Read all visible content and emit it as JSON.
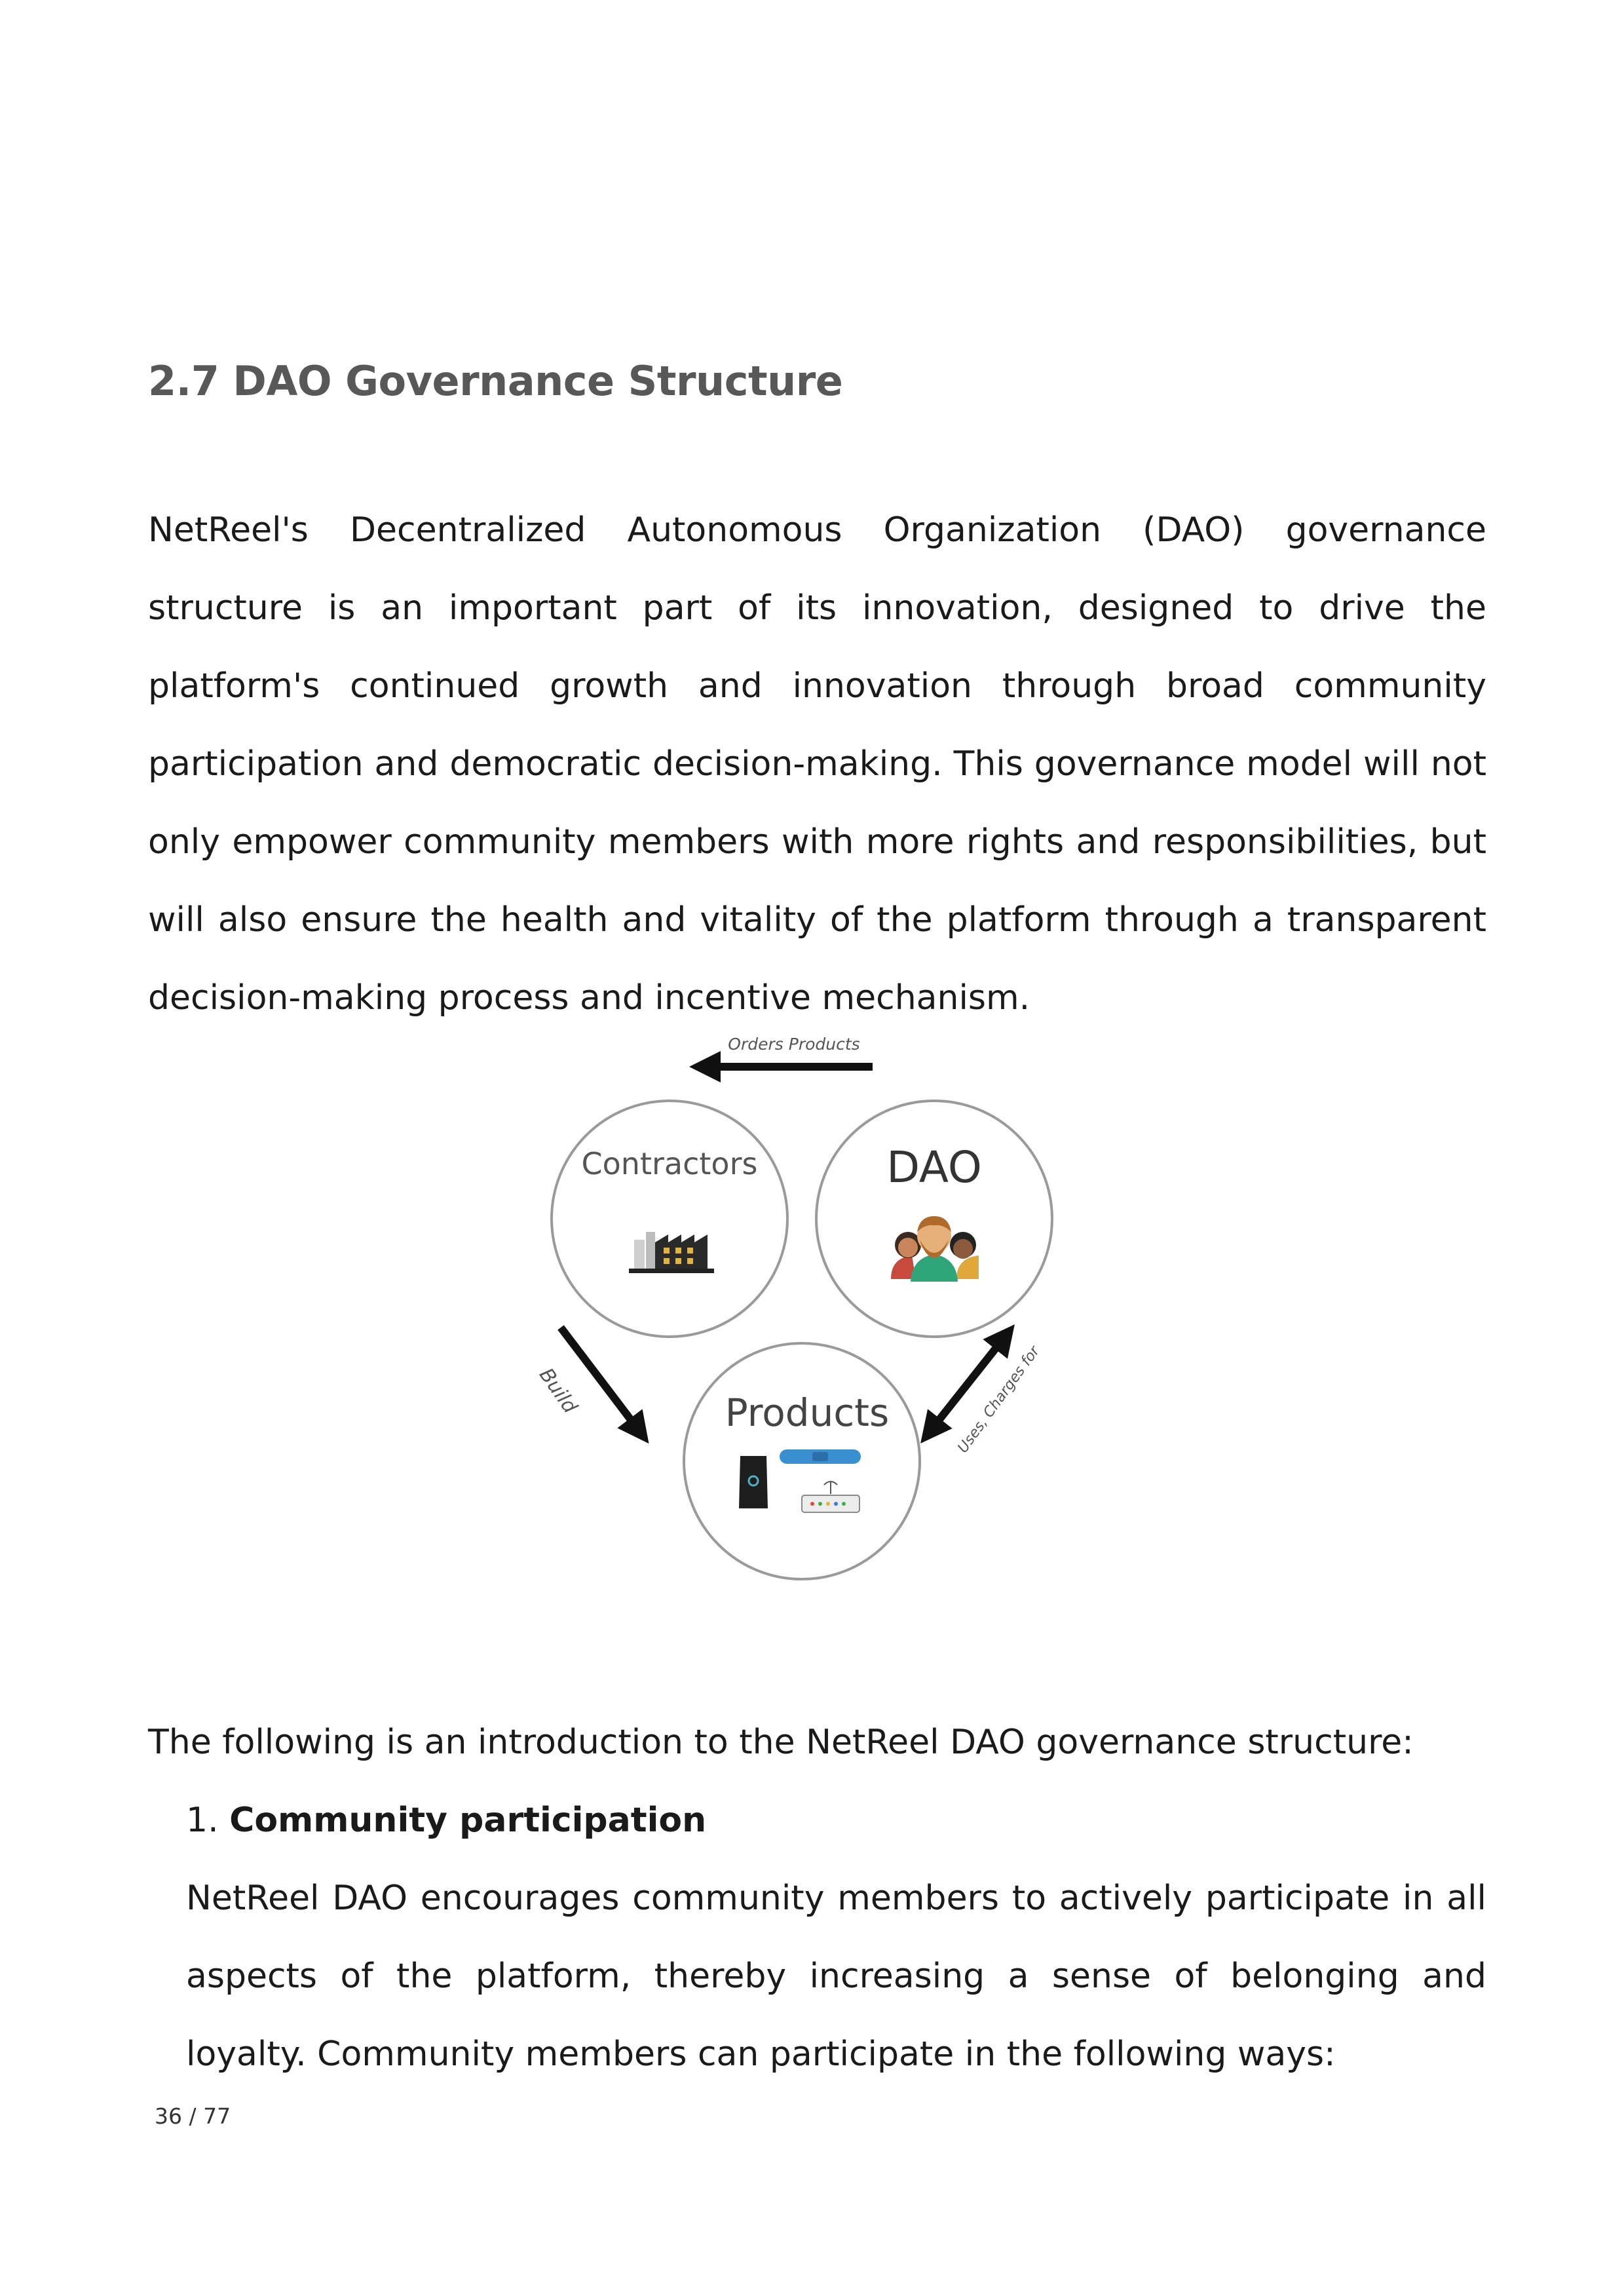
{
  "section": {
    "title": "2.7 DAO Governance Structure",
    "intro": "NetReel's Decentralized Autonomous Organization (DAO) governance structure is an important part of its innovation, designed to drive the platform's continued growth and innovation through broad community participation and democratic decision-making. This governance model will not only empower community members with more rights and responsibilities, but will also ensure the health and vitality of the platform through a transparent decision-making process and incentive mechanism."
  },
  "diagram": {
    "nodes": {
      "contractors": "Contractors",
      "dao": "DAO",
      "products": "Products"
    },
    "edges": {
      "orders_products": "Orders Products",
      "build": "Build",
      "uses_charges_for": "Uses, Charges for"
    },
    "icons": [
      "factory-icon",
      "people-icon",
      "device-icon",
      "wristband-icon",
      "router-icon"
    ]
  },
  "structure_intro": "The following is an introduction to the NetReel DAO governance structure:",
  "list": {
    "item1_number": "1.",
    "item1_heading": "Community participation",
    "item1_text": "NetReel DAO encourages community members to actively participate in all aspects of the platform, thereby increasing a sense of belonging and loyalty. Community members can participate in the following ways:"
  },
  "footer": {
    "page": "36 / 77"
  }
}
